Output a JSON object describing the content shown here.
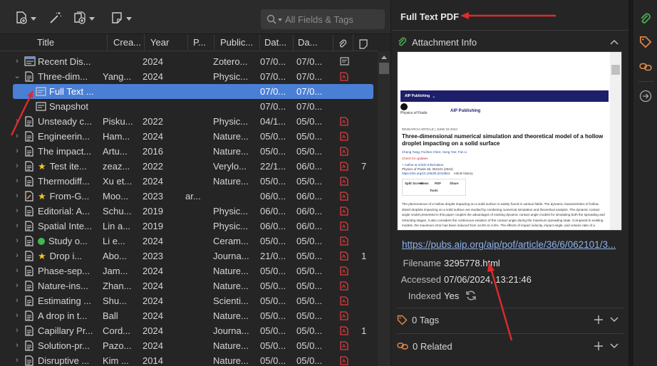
{
  "toolbar": {
    "new_item_icon": "new-item-icon",
    "magic_wand_icon": "add-by-identifier-icon",
    "new_attachment_icon": "new-attachment-icon",
    "new_note_icon": "new-note-icon",
    "search_placeholder": "All Fields & Tags"
  },
  "columns": {
    "title": "Title",
    "creator": "Crea...",
    "year": "Year",
    "p": "P...",
    "publication": "Public...",
    "date_added": "Dat...",
    "date_modified": "Da..."
  },
  "rows": [
    {
      "title": "Recent Dis...",
      "creator": "",
      "year": "2024",
      "p": "",
      "pub": "Zotero...",
      "d1": "07/0...",
      "d2": "07/0...",
      "count": "",
      "type": "webpage",
      "twisty": "›"
    },
    {
      "title": "Three-dim...",
      "creator": "Yang...",
      "year": "2024",
      "p": "",
      "pub": "Physic...",
      "d1": "07/0...",
      "d2": "07/0...",
      "count": "",
      "type": "doc",
      "twisty": "⌄"
    },
    {
      "title": "Full Text ...",
      "creator": "",
      "year": "",
      "p": "",
      "pub": "",
      "d1": "07/0...",
      "d2": "07/0...",
      "count": "",
      "type": "snapshot",
      "twisty": ""
    },
    {
      "title": "Snapshot",
      "creator": "",
      "year": "",
      "p": "",
      "pub": "",
      "d1": "07/0...",
      "d2": "07/0...",
      "count": "",
      "type": "snapshot",
      "twisty": ""
    },
    {
      "title": "Unsteady c...",
      "creator": "Pisku...",
      "year": "2022",
      "p": "",
      "pub": "Physic...",
      "d1": "04/1...",
      "d2": "05/0...",
      "count": "",
      "type": "doc",
      "twisty": "›"
    },
    {
      "title": "Engineerin...",
      "creator": "Ham...",
      "year": "2024",
      "p": "",
      "pub": "Nature...",
      "d1": "05/0...",
      "d2": "05/0...",
      "count": "",
      "type": "doc",
      "twisty": "›"
    },
    {
      "title": "The impact...",
      "creator": "Artu...",
      "year": "2016",
      "p": "",
      "pub": "Nature...",
      "d1": "05/0...",
      "d2": "05/0...",
      "count": "",
      "type": "doc",
      "twisty": "›"
    },
    {
      "title": "Test ite...",
      "creator": "zeaz...",
      "year": "2022",
      "p": "",
      "pub": "Verylo...",
      "d1": "22/1...",
      "d2": "06/0...",
      "count": "7",
      "type": "doc",
      "twisty": "›",
      "flag": "star"
    },
    {
      "title": "Thermodiff...",
      "creator": "Xu et...",
      "year": "2024",
      "p": "",
      "pub": "Nature...",
      "d1": "05/0...",
      "d2": "05/0...",
      "count": "",
      "type": "doc",
      "twisty": "›"
    },
    {
      "title": "From-G...",
      "creator": "Moo...",
      "year": "2023",
      "p": "ar...",
      "pub": "",
      "d1": "06/0...",
      "d2": "06/0...",
      "count": "",
      "type": "preprint",
      "twisty": "›",
      "flag": "star"
    },
    {
      "title": "Editorial: A...",
      "creator": "Schu...",
      "year": "2019",
      "p": "",
      "pub": "Physic...",
      "d1": "06/0...",
      "d2": "06/0...",
      "count": "",
      "type": "doc",
      "twisty": "›"
    },
    {
      "title": "Spatial Inte...",
      "creator": "Lin a...",
      "year": "2019",
      "p": "",
      "pub": "Physic...",
      "d1": "06/0...",
      "d2": "06/0...",
      "count": "",
      "type": "doc",
      "twisty": "›"
    },
    {
      "title": "Study o...",
      "creator": "Li e...",
      "year": "2024",
      "p": "",
      "pub": "Ceram...",
      "d1": "05/0...",
      "d2": "05/0...",
      "count": "",
      "type": "doc",
      "twisty": "›",
      "flag": "dot"
    },
    {
      "title": "Drop i...",
      "creator": "Abo...",
      "year": "2023",
      "p": "",
      "pub": "Journa...",
      "d1": "21/0...",
      "d2": "05/0...",
      "count": "1",
      "type": "doc",
      "twisty": "›",
      "flag": "star"
    },
    {
      "title": "Phase-sep...",
      "creator": "Jam...",
      "year": "2024",
      "p": "",
      "pub": "Nature...",
      "d1": "05/0...",
      "d2": "05/0...",
      "count": "",
      "type": "doc",
      "twisty": "›"
    },
    {
      "title": "Nature-ins...",
      "creator": "Zhan...",
      "year": "2024",
      "p": "",
      "pub": "Nature...",
      "d1": "05/0...",
      "d2": "05/0...",
      "count": "",
      "type": "doc",
      "twisty": "›"
    },
    {
      "title": "Estimating ...",
      "creator": "Shu...",
      "year": "2024",
      "p": "",
      "pub": "Scienti...",
      "d1": "05/0...",
      "d2": "05/0...",
      "count": "",
      "type": "doc",
      "twisty": "›"
    },
    {
      "title": "A drop in t...",
      "creator": "Ball",
      "year": "2024",
      "p": "",
      "pub": "Nature...",
      "d1": "05/0...",
      "d2": "05/0...",
      "count": "",
      "type": "doc",
      "twisty": "›"
    },
    {
      "title": "Capillary Pr...",
      "creator": "Cord...",
      "year": "2024",
      "p": "",
      "pub": "Journa...",
      "d1": "05/0...",
      "d2": "05/0...",
      "count": "1",
      "type": "doc",
      "twisty": "›"
    },
    {
      "title": "Solution-pr...",
      "creator": "Pazo...",
      "year": "2024",
      "p": "",
      "pub": "Nature...",
      "d1": "05/0...",
      "d2": "05/0...",
      "count": "",
      "type": "doc",
      "twisty": "›"
    },
    {
      "title": "Disruptive ...",
      "creator": "Kim ...",
      "year": "2014",
      "p": "",
      "pub": "Nature...",
      "d1": "05/0...",
      "d2": "05/0...",
      "count": "",
      "type": "doc",
      "twisty": "›"
    }
  ],
  "right_pane": {
    "title": "Full Text PDF",
    "attachment_info": "Attachment Info",
    "preview": {
      "nav_brand": "AIP Publishing",
      "journal": "Physics of Fluids",
      "publisher": "AIP Publishing",
      "section": "RESEARCH ARTICLE  |  JUNE 03 2024",
      "article_title": "Three-dimensional numerical simulation and theoretical model of a hollow droplet impacting on a solid surface",
      "authors": "Cheng Yang; Fuchen Chen; Hong Yan; Fan Li",
      "check_updates": "Check for updates",
      "author_info": "+ Author & Article Information",
      "citation": "Physics of Fluids 36, 062101 (2024)",
      "doi": "https://doi.org/10.1063/5.0210954",
      "article_history": "Article history",
      "tools": [
        "Split Screen",
        "Views",
        "PDF",
        "Share",
        "Tools"
      ],
      "abstract": "The phenomenon of a hollow droplet impacting on a solid surface is widely found in various fields. The dynamic characteristics of hollow diesel droplets impacting on a solid surface are studied by combining numerical simulation and theoretical analysis. The dynamic contact angle model presented in this paper couples the advantages of existing dynamic contact angle models for simulating both the spreading and retracting stages. It also considers the continuous variation of the contact angle during the maximum spreading state. Compared to existing models, the maximum error has been reduced from 14.9% to 4.6%. The effects of impact velocity, impact angle, and volume ratio of a"
    },
    "url": "https://pubs.aip.org/aip/pof/article/36/6/062101/3...",
    "filename_label": "Filename",
    "filename_value": "3295778.html",
    "accessed_label": "Accessed",
    "accessed_value": "07/06/2024, 13:21:46",
    "indexed_label": "Indexed",
    "indexed_value": "Yes",
    "tags_label": "0 Tags",
    "related_label": "0 Related"
  },
  "colors": {
    "selection": "#4a7fd6",
    "pdf_icon": "#e03c3c",
    "annotation_arrow": "#e02a2a",
    "star": "#f5c518",
    "green_dot": "#3fb950",
    "link": "#8fb2ea"
  }
}
